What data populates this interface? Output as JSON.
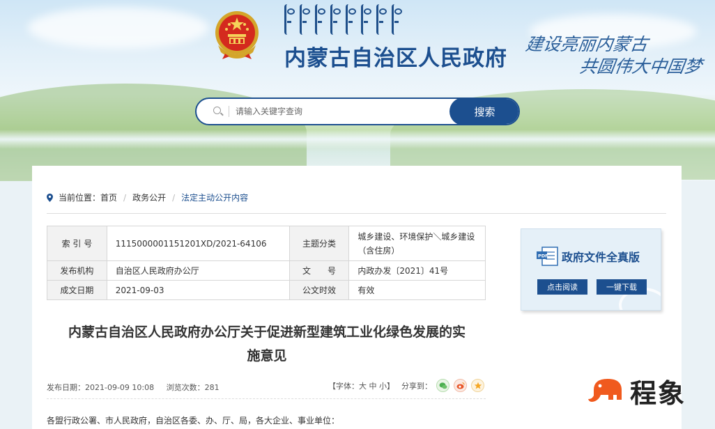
{
  "header": {
    "title": "内蒙古自治区人民政府",
    "slogan_line1": "建设亮丽内蒙古",
    "slogan_line2": "共圆伟大中国梦"
  },
  "search": {
    "placeholder": "请输入关键字查询",
    "button_label": "搜索"
  },
  "breadcrumb": {
    "prefix": "当前位置：",
    "items": [
      "首页",
      "政务公开",
      "法定主动公开内容"
    ],
    "separator": "/"
  },
  "meta_table": {
    "rows": [
      {
        "k1": "索 引 号",
        "v1": "11150000011512 01XD/2021-64106",
        "k2": "主题分类",
        "v2": "城乡建设、环境保护＼城乡建设（含住房）"
      },
      {
        "k1": "发布机构",
        "v1": "自治区人民政府办公厅",
        "k2": "文　　号",
        "v2": "内政办发〔2021〕41号"
      },
      {
        "k1": "成文日期",
        "v1": "2021-09-03",
        "k2": "公文时效",
        "v2": "有效"
      }
    ]
  },
  "document": {
    "title_line1": "内蒙古自治区人民政府办公厅关于促进新型建筑工业化绿色发展的实",
    "title_line2": "施意见",
    "publish_date": "发布日期：2021-09-09 10:08",
    "views": "浏览次数：281",
    "font_label": "【字体：",
    "font_large": "大",
    "font_medium": "中",
    "font_small": "小】",
    "share_label": "分享到：",
    "salutation": "各盟行政公署、市人民政府，自治区各委、办、厅、局，各大企业、事业单位："
  },
  "full_version": {
    "title": "政府文件全真版",
    "read_button": "点击阅读",
    "download_button": "一键下载"
  },
  "watermark": {
    "text": "程象"
  },
  "colors": {
    "primary": "#1c4f8f",
    "watermark_orange": "#f05a1e"
  },
  "icons": [
    "national-emblem-icon",
    "search-icon",
    "location-pin-icon",
    "wechat-icon",
    "weibo-icon",
    "favorite-icon",
    "pdf-icon",
    "elephant-logo-icon"
  ]
}
